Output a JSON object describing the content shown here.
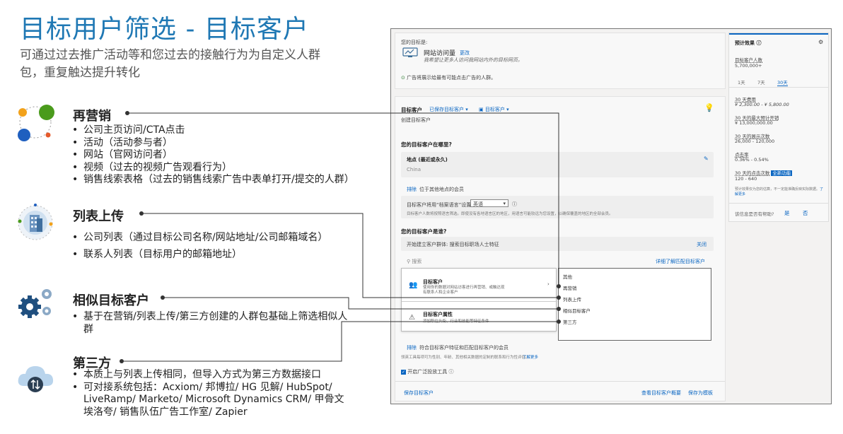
{
  "slide": {
    "title": "目标用户筛选 - 目标客户",
    "subtitle": "可通过过去推广活动等和您过去的接触行为为自定义人群包，重复触达提升转化"
  },
  "categories": [
    {
      "heading": "再营销",
      "bullets": [
        "公司主页访问/CTA点击",
        "活动（活动参与者）",
        "网站（官网访问者）",
        "视频（过去的视频广告观看行为）",
        "销售线索表格（过去的销售线索广告中表单打开/提交的人群）"
      ]
    },
    {
      "heading": "列表上传",
      "bullets": [
        "公司列表（通过目标公司名称/网站地址/公司邮箱域名）",
        "联系人列表（目标用户的邮箱地址）"
      ]
    },
    {
      "heading": "相似目标客户",
      "bullets": [
        "基于在营销/列表上传/第三方创建的人群包基础上筛选相似人群"
      ]
    },
    {
      "heading": "第三方",
      "bullets": [
        "本质上与列表上传相同，但导入方式为第三方数据接口",
        "可对接系统包括：Acxiom/ 邦博拉/ HG 见解/ HubSpot/ LiveRamp/ Marketo/ Microsoft Dynamics CRM/ 甲骨文埃洛夸/ 销售队伍广告工作室/ Zapier"
      ]
    }
  ],
  "panel": {
    "objective": {
      "label": "您的目标是:",
      "name": "网站访问量",
      "change": "更改",
      "desc": "我希望让更多人访问我网站内外的目标网页。",
      "note": "广告将展示给最有可能点击广告的人群。"
    },
    "audience": {
      "title": "目标客户",
      "saved": "已保存目标客户 ▾",
      "template": "目标客户 ▾",
      "create": "创建目标客户",
      "where_title": "您的目标客户在哪里?",
      "location_label": "地点 (最近或永久)",
      "location_value": "China",
      "exclude": "排除",
      "exclude_desc": "位于其他地点的会员",
      "lang_prefix": "目标客户将用“档案语言”设置为",
      "lang_value": "英语",
      "lang_note": "目标客户人数将按照语言筛选。即使没有各地语言区的地区，用语言可能较远为您设置，以确保覆盖的地区的全部会员。",
      "who_title": "您的目标客户是谁?",
      "who_desc": "开始建立客户群体: 搜索目标职场人士特征",
      "close": "关闭",
      "search_placeholder": "搜索",
      "learn_more": "详细了解匹配目标客户",
      "exclude2": "排除",
      "exclude2_desc": "符合目标客户特征和匹配目标客户的会员",
      "legal": "领英工具每项可为性别、年龄、其他相关数据的定制的联系和行为性评估。",
      "legal_link": "了解更多",
      "expansion": "开启广泛投放工具",
      "footer_left": "保存目标客户",
      "footer_mid": "查看目标客户概要",
      "footer_right": "保存为模板"
    },
    "popup": {
      "item1_title": "目标客户",
      "item1_desc": "使用你的数据对网站访客进行再营销、或触达现有联系人和企业客户",
      "item2_title": "目标客户属性",
      "item2_desc": "添加职位头衔、行业和技能等特征条件"
    },
    "dropdown": [
      "其他",
      "再营销",
      "列表上传",
      "相似目标客户",
      "第三方"
    ],
    "forecast": {
      "title": "预计效果",
      "audience_label": "目标客户人数",
      "audience_value": "5,700,000+",
      "tabs": [
        "1天",
        "7天",
        "30天"
      ],
      "spend_label": "30 天费用",
      "spend_value": "¥ 2,300.00 - ¥ 5,800.00",
      "budget_label": "30 天的最大预计开销",
      "budget_value": "¥ 13,000,000.00",
      "impr_label": "30 天的展示次数",
      "impr_value": "26,000 - 120,000",
      "ctr_label": "点击率",
      "ctr_value": "0.36% - 0.54%",
      "clicks_label": "30 天的点击次数",
      "clicks_badge": "全新功能",
      "clicks_value": "120 - 640",
      "note": "预计效果仅为您的估算，不一定能准确反映实际数据。",
      "note_link": "了解更多",
      "helpful": "该信息是否有帮助?",
      "yes": "是",
      "no": "否"
    }
  }
}
